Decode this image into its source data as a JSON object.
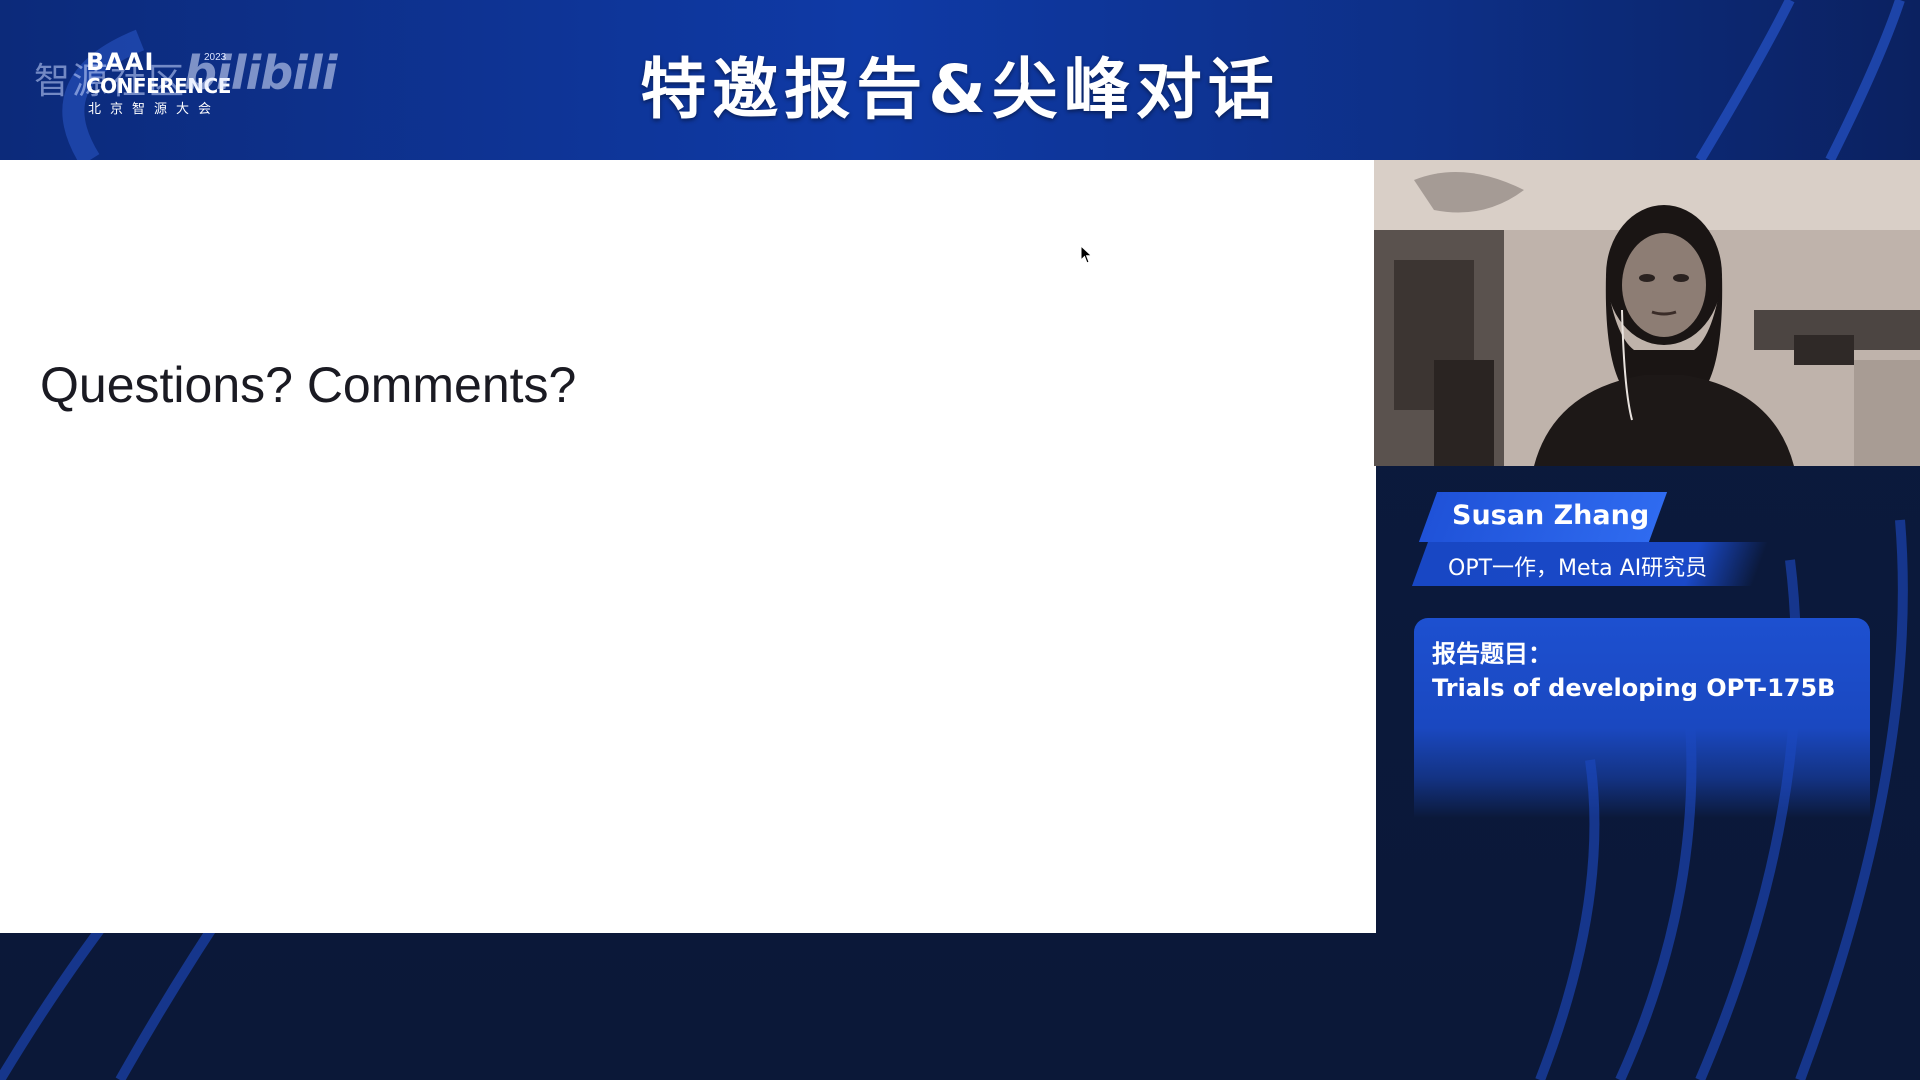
{
  "header": {
    "title": "特邀报告&尖峰对话",
    "brand": {
      "cn_mark": "智源社区",
      "baai": "BAAI",
      "conference": "CONFERENCE",
      "year": "2023",
      "subtitle": "北京智源大会",
      "platform": "bilibili"
    }
  },
  "slide": {
    "text": "Questions? Comments?"
  },
  "speaker": {
    "name": "Susan Zhang",
    "role": "OPT一作，Meta AI研究员",
    "topic_label": "报告题目：",
    "topic_title": "Trials of developing OPT-175B"
  },
  "colors": {
    "accent_blue": "#1f52d8",
    "header_blue": "#0f3aa6",
    "background_navy": "#0b1a3d",
    "slide_bg": "#ffffff"
  },
  "icons": {
    "cursor": "mouse-pointer-icon",
    "webcam": "speaker-video-feed"
  }
}
